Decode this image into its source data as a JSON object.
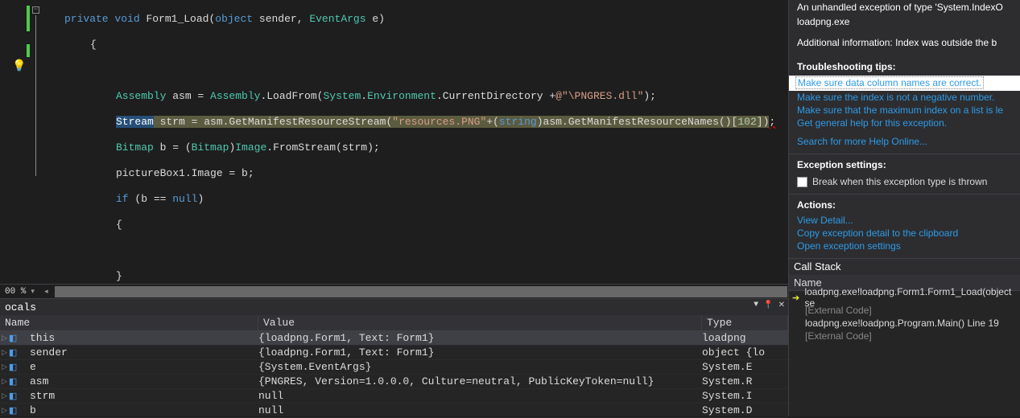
{
  "code": {
    "l1_kw1": "private",
    "l1_kw2": "void",
    "l1_m": "Form1_Load(",
    "l1_kw3": "object",
    "l1_s": " sender, ",
    "l1_t": "EventArgs",
    "l1_e": " e)",
    "l2": "{",
    "l3a": "Assembly",
    "l3b": " asm = ",
    "l3c": "Assembly",
    "l3d": ".LoadFrom(",
    "l3e": "System",
    "l3f": ".",
    "l3g": "Environment",
    "l3h": ".CurrentDirectory +",
    "l3i": "@\"\\PNGRES.dll\"",
    "l3j": ");",
    "l4a": "Stream",
    "l4b": " strm = asm.GetManifestResourceStream(",
    "l4c": "\"resources.PNG\"",
    "l4d": "+(",
    "l4e": "string",
    "l4f": ")asm.GetManifestResourceNames()[",
    "l4g": "102",
    "l4h": "])",
    "l5a": "Bitmap",
    "l5b": " b = (",
    "l5c": "Bitmap",
    "l5d": ")",
    "l5e": "Image",
    "l5f": ".FromStream(strm);",
    "l6": "pictureBox1.Image = b;",
    "l7a": "if",
    "l7b": " (b == ",
    "l7c": "null",
    "l7d": ")",
    "l8": "{",
    "l9": "}",
    "l10": "}",
    "l11": "}"
  },
  "zoom": "00 %",
  "locals": {
    "title": "ocals",
    "col_name": "Name",
    "col_value": "Value",
    "col_type": "Type",
    "rows": [
      {
        "name": "this",
        "value": "{loadpng.Form1, Text: Form1}",
        "type": "loadpng"
      },
      {
        "name": "sender",
        "value": "{loadpng.Form1, Text: Form1}",
        "type": "object {lo"
      },
      {
        "name": "e",
        "value": "{System.EventArgs}",
        "type": "System.E"
      },
      {
        "name": "asm",
        "value": "{PNGRES, Version=1.0.0.0, Culture=neutral, PublicKeyToken=null}",
        "type": "System.R"
      },
      {
        "name": "strm",
        "value": "null",
        "type": "System.I"
      },
      {
        "name": "b",
        "value": "null",
        "type": "System.D"
      }
    ]
  },
  "exc": {
    "line1": "An unhandled exception of type 'System.IndexO",
    "line2": "loadpng.exe",
    "line3": "Additional information: Index was outside the b",
    "tips_h": "Troubleshooting tips:",
    "t1": "Make sure data column names are correct.",
    "t2": "Make sure the index is not a negative number.",
    "t3": "Make sure that the maximum index on a list is le",
    "t4": "Get general help for this exception.",
    "search": "Search for more Help Online...",
    "settings_h": "Exception settings:",
    "chk": "Break when this exception type is thrown",
    "actions_h": "Actions:",
    "a1": "View Detail...",
    "a2": "Copy exception detail to the clipboard",
    "a3": "Open exception settings"
  },
  "cs": {
    "title": "Call Stack",
    "col": "Name",
    "r1": "loadpng.exe!loadpng.Form1.Form1_Load(object se",
    "r2": "[External Code]",
    "r3": "loadpng.exe!loadpng.Program.Main() Line 19",
    "r4": "[External Code]"
  }
}
